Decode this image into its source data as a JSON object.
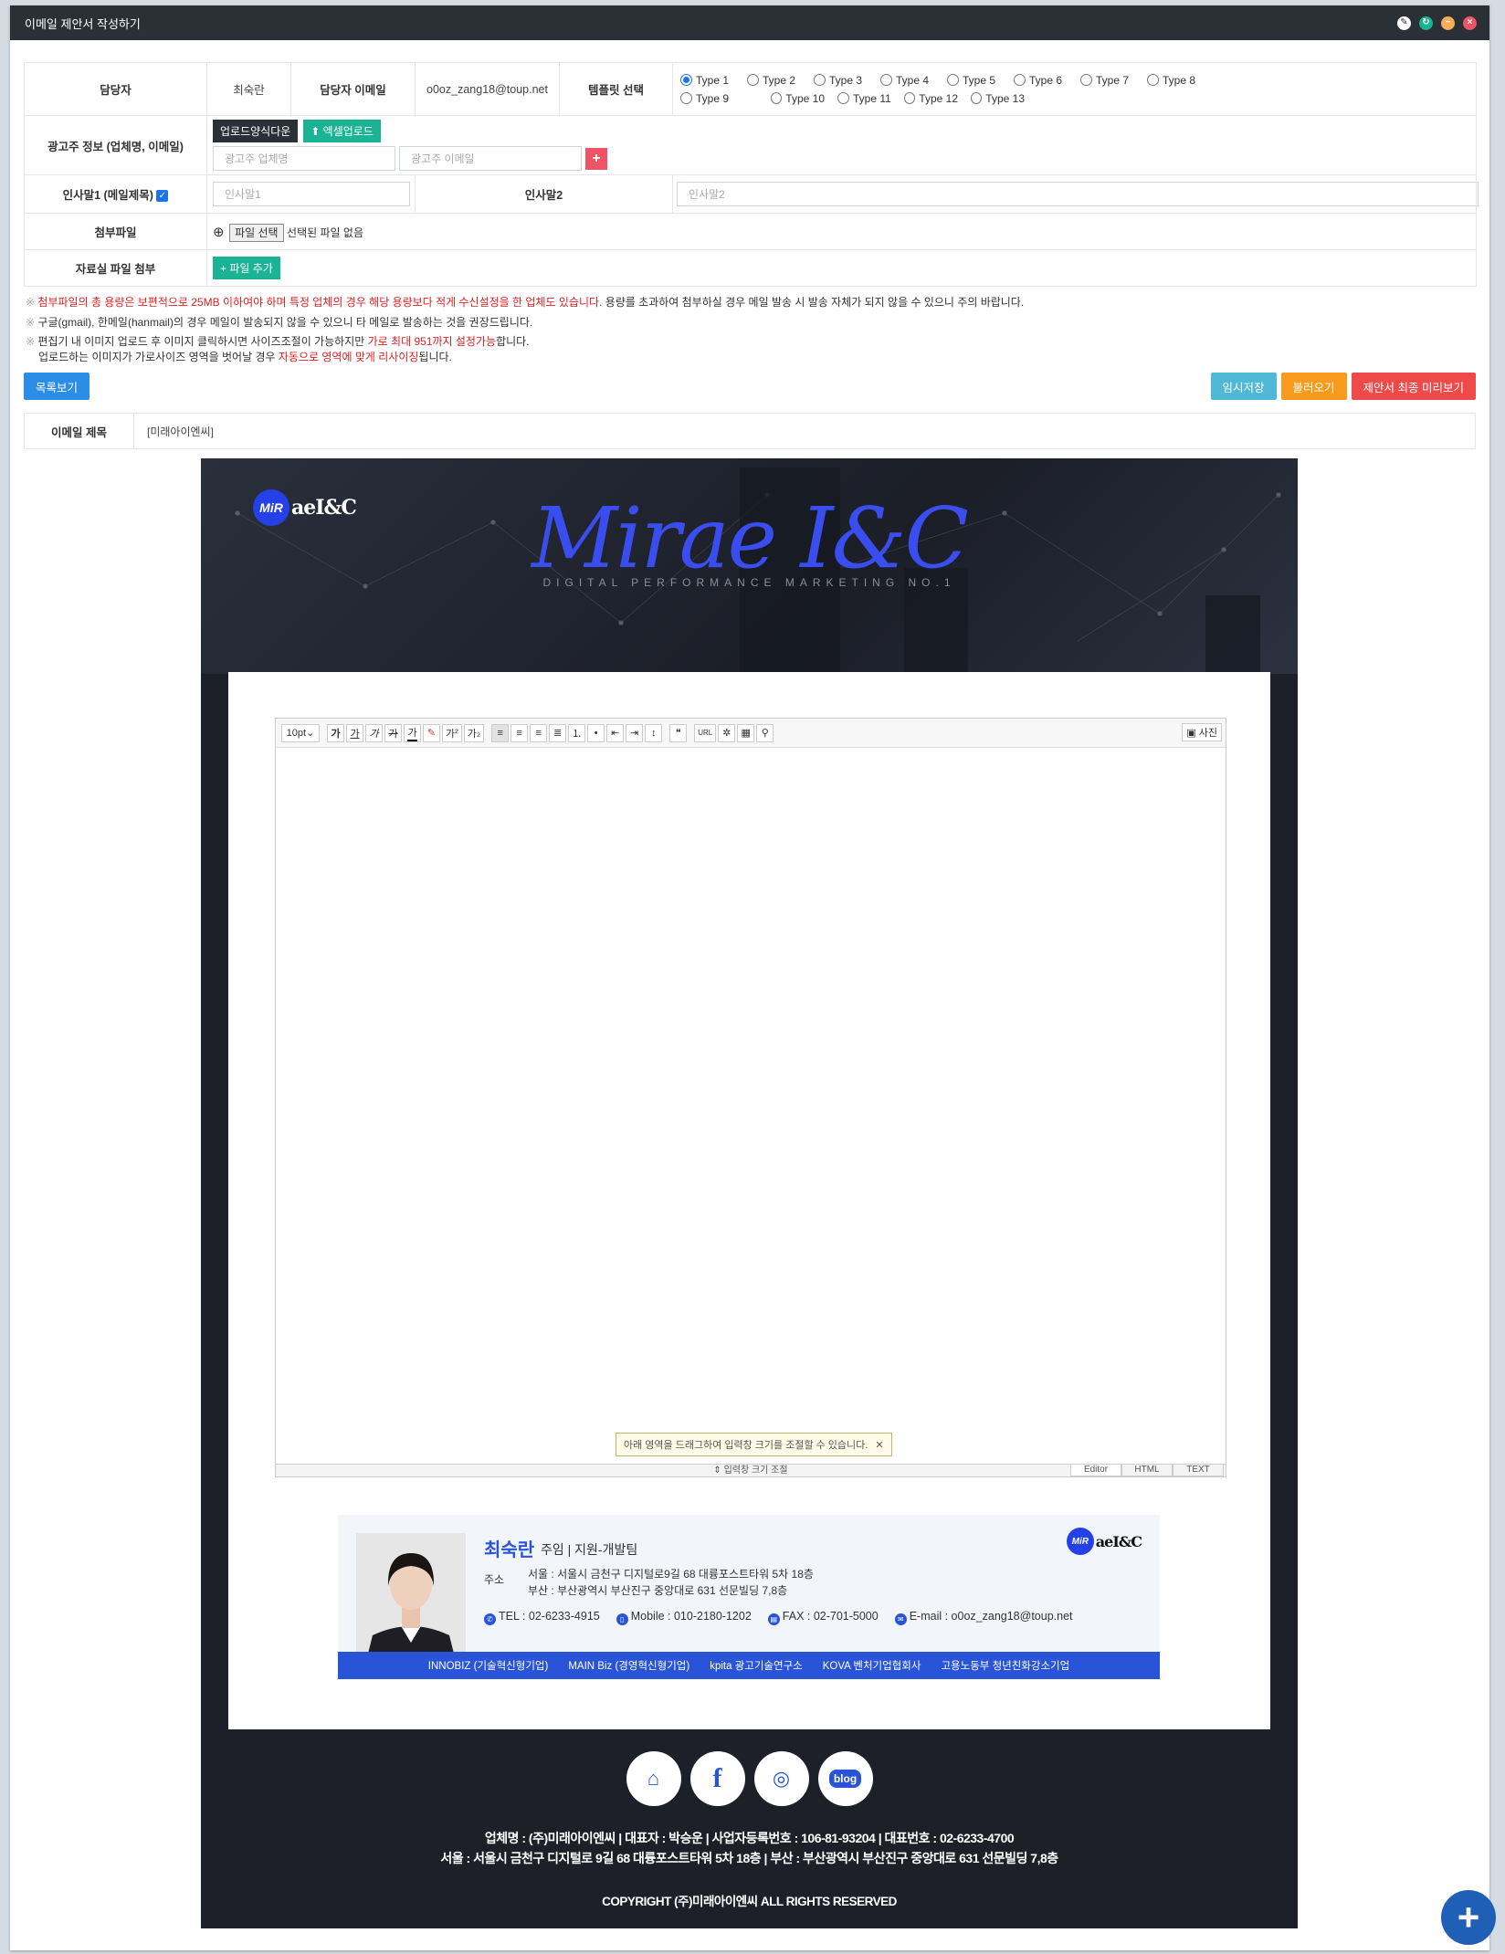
{
  "window": {
    "title": "이메일 제안서 작성하기",
    "controls": [
      "pin-icon",
      "refresh-icon",
      "minimize-icon",
      "close-icon"
    ]
  },
  "form": {
    "manager_label": "담당자",
    "manager_value": "최숙란",
    "manager_email_label": "담당자 이메일",
    "manager_email_value": "o0oz_zang18@toup.net",
    "template_label": "템플릿 선택",
    "template_options": [
      "Type 1",
      "Type 2",
      "Type 3",
      "Type 4",
      "Type 5",
      "Type 6",
      "Type 7",
      "Type 8",
      "Type 9",
      "Type 10",
      "Type 11",
      "Type 12",
      "Type 13"
    ],
    "template_selected": "Type 1",
    "advertiser_label": "광고주 정보 (업체명, 이메일)",
    "upload_form_btn": "업로드양식다운",
    "excel_upload_btn": "엑셀업로드",
    "advertiser_name_placeholder": "광고주 업체명",
    "advertiser_email_placeholder": "광고주 이메일",
    "greeting1_label": "인사말1 (메일제목)",
    "greeting1_placeholder": "인사말1",
    "greeting2_label": "인사말2",
    "greeting2_placeholder": "인사말2",
    "attachment_label": "첨부파일",
    "file_select_btn": "파일 선택",
    "file_none_text": "선택된 파일 없음",
    "library_label": "자료실 파일 첨부",
    "add_file_btn": "파일 추가"
  },
  "notes": {
    "mark": "※",
    "line1_red": "첨부파일의 총 용량은 보편적으로 25MB 이하여야 하며 특정 업체의 경우 해당 용량보다 적게 수신설정을 한 업체도 있습니다.",
    "line1_rest": " 용량를 초과하여 첨부하실 경우 메일 발송 시 발송 자체가 되지 않을 수 있으니 주의 바랍니다.",
    "line2": "구글(gmail), 한메일(hanmail)의 경우 메일이 발송되지 않을 수 있으니 타 메일로 발송하는 것을 권장드립니다.",
    "line3_a": "편집기 내 이미지 업로드 후 이미지 클릭하시면 사이즈조절이 가능하지만 ",
    "line3_red": "가로 최대 951까지 설정가능",
    "line3_b": "합니다.",
    "line4_a": "업로드하는 이미지가 가로사이즈 영역을 벗어날 경우 ",
    "line4_red": "자동으로 영역에 맞게 리사이징",
    "line4_b": "됩니다."
  },
  "actions": {
    "list_btn": "목록보기",
    "temp_save_btn": "임시저장",
    "load_btn": "불러오기",
    "final_preview_btn": "제안서 최종 미리보기"
  },
  "subject": {
    "label": "이메일 제목",
    "value": "[미래아이엔씨]"
  },
  "preview": {
    "logo_badge": "MiR",
    "logo_text": "aeI&C",
    "brand": "Mirae I&C",
    "brand_sub": "DIGITAL PERFORMANCE MARKETING NO.1",
    "editor": {
      "font_size": "10pt",
      "toolbar": [
        "가",
        "가",
        "가",
        "가",
        "가",
        "가",
        "가",
        "가"
      ],
      "photo_btn": "사진",
      "tooltip": "아래 영역을 드래그하여 입력창 크기를 조절할 수 있습니다.",
      "resize_label": "입력창 크기 조절",
      "modes": [
        "Editor",
        "HTML",
        "TEXT"
      ]
    },
    "signature": {
      "name": "최숙란",
      "role": "주임 | 지원-개발팀",
      "addr_label": "주소",
      "addr1": "서울 : 서울시 금천구 디지털로9길 68 대륭포스트타워 5차 18층",
      "addr2": "부산 : 부산광역시 부산진구 중앙대로 631 선문빌딩 7,8층",
      "tel": "TEL : 02-6233-4915",
      "mobile": "Mobile : 010-2180-1202",
      "fax": "FAX : 02-701-5000",
      "email": "E-mail : o0oz_zang18@toup.net",
      "certs": [
        "INNOBIZ (기술혁신형기업)",
        "MAIN Biz (경영혁신형기업)",
        "kpita 광고기술연구소",
        "KOVA 벤처기업협회사",
        "고용노동부 청년친화강소기업"
      ]
    },
    "socials": [
      "home-icon",
      "facebook-icon",
      "instagram-icon",
      "blog-icon"
    ],
    "blog_label": "blog",
    "footer_line1": "업체명 : (주)미래아이엔씨 | 대표자 : 박승운 | 사업자등록번호 : 106-81-93204 | 대표번호 : 02-6233-4700",
    "footer_line2": "서울 : 서울시 금천구 디지털로 9길 68 대륭포스트타워 5차 18층 | 부산 : 부산광역시 부산진구 중앙대로 631 선문빌딩 7,8층",
    "copyright": "COPYRIGHT (주)미래아이엔씨 ALL RIGHTS RESERVED"
  },
  "colors": {
    "titlebar": "#2b2f36",
    "accent_blue": "#2b8de6",
    "brand_blue": "#3a4ef0",
    "teal": "#1ab394",
    "red": "#ee4a4a"
  }
}
